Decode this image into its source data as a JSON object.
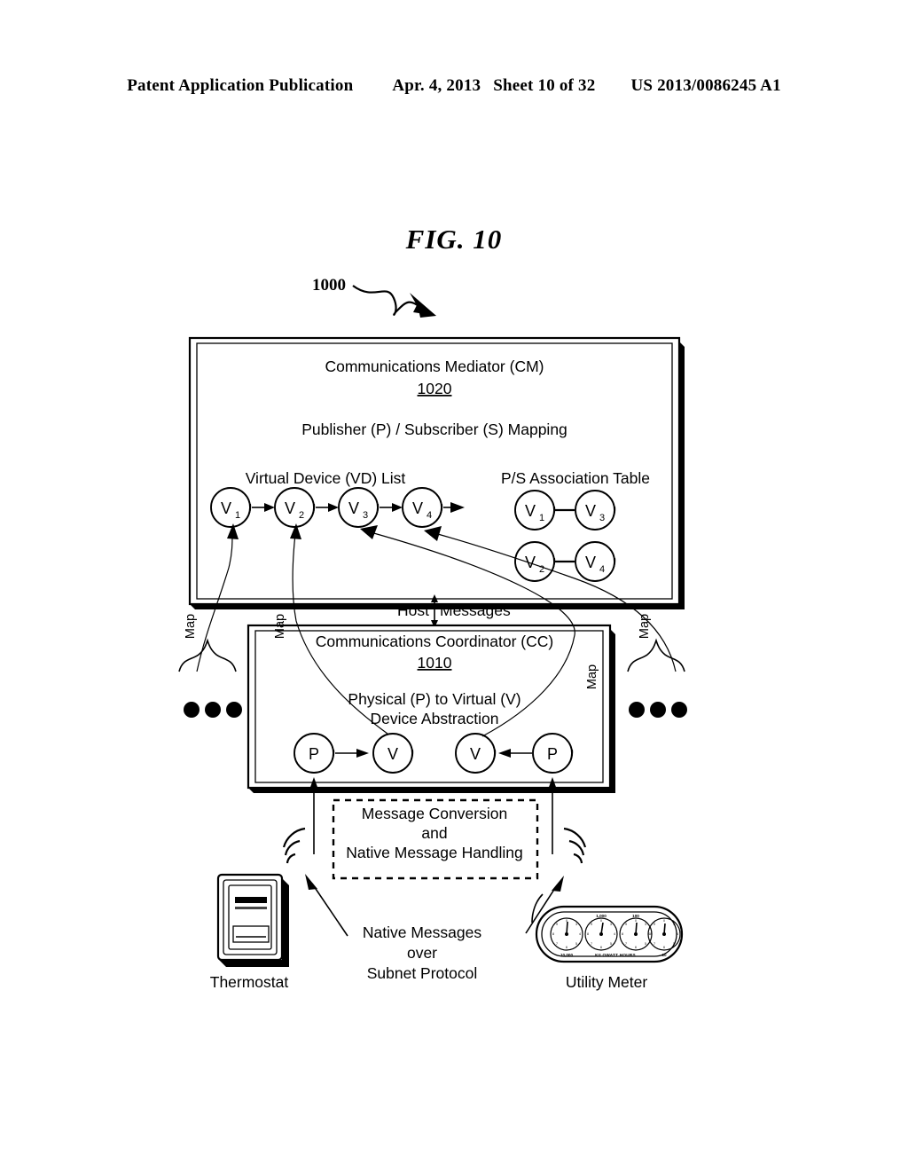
{
  "header": {
    "publication": "Patent Application Publication",
    "date": "Apr. 4, 2013",
    "sheet": "Sheet 10 of 32",
    "docnum": "US 2013/0086245 A1"
  },
  "figure": {
    "title": "FIG. 10",
    "ref_number": "1000"
  },
  "mediator": {
    "title": "Communications Mediator (CM)",
    "ref": "1020",
    "subtitle": "Publisher (P) / Subscriber (S) Mapping",
    "vd_list_label": "Virtual Device (VD) List",
    "vd_nodes": [
      "V",
      "V",
      "V",
      "V"
    ],
    "vd_subs": [
      "1",
      "2",
      "3",
      "4"
    ],
    "ps_table_label": "P/S Association Table",
    "ps_pairs": [
      {
        "left": "V",
        "left_sub": "1",
        "right": "V",
        "right_sub": "3"
      },
      {
        "left": "V",
        "left_sub": "2",
        "right": "V",
        "right_sub": "4"
      }
    ]
  },
  "host_messages_label": "Host  Messages",
  "host_messages_left": "Host",
  "host_messages_right": "Messages",
  "map_labels": [
    "Map",
    "Map",
    "Map",
    "Map"
  ],
  "coordinator": {
    "title": "Communications Coordinator (CC)",
    "ref": "1010",
    "abstraction_line1": "Physical (P) to Virtual (V)",
    "abstraction_line2": "Device Abstraction",
    "nodes": [
      "P",
      "V",
      "V",
      "P"
    ]
  },
  "conversion_box": {
    "line1": "Message Conversion",
    "line2": "and",
    "line3": "Native Message Handling"
  },
  "native_caption": {
    "line1": "Native Messages",
    "line2": "over",
    "line3": "Subnet Protocol"
  },
  "devices": {
    "thermostat_label": "Thermostat",
    "meter_label": "Utility Meter",
    "meter_dials": [
      "10,000",
      "1,000",
      "100",
      "10"
    ],
    "meter_units": "KILOWATT HOURS",
    "meter_tick_digits": [
      "0",
      "9",
      "8",
      "7",
      "6",
      "5",
      "4",
      "3",
      "2",
      "1"
    ]
  },
  "icons": {
    "wireless_left": "wireless-signal-icon",
    "wireless_right": "wireless-signal-icon"
  },
  "ellipsis": {
    "left": "continuation-dots",
    "right": "continuation-dots",
    "count": 3
  },
  "colors": {
    "ink": "#000000",
    "paper": "#ffffff"
  }
}
